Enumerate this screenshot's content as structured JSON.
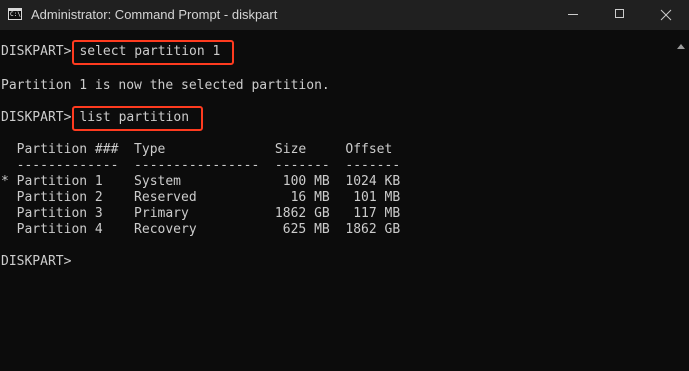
{
  "window": {
    "title": "Administrator: Command Prompt - diskpart",
    "controls": [
      "minimize-icon",
      "maximize-icon",
      "close-icon"
    ],
    "colors": {
      "background": "#0c0c0c",
      "titlebar": "#202020",
      "text": "#cccccc",
      "highlight": "#ff3b1f"
    }
  },
  "console": {
    "prompt1": "DISKPART>",
    "command1": "select partition 1",
    "output1": "Partition 1 is now the selected partition.",
    "prompt2": "DISKPART>",
    "command2": "list partition",
    "header": "  Partition ###  Type              Size     Offset",
    "separator": "  -------------  ----------------  -------  -------",
    "rows": [
      "* Partition 1    System             100 MB  1024 KB",
      "  Partition 2    Reserved            16 MB   101 MB",
      "  Partition 3    Primary           1862 GB   117 MB",
      "  Partition 4    Recovery           625 MB  1862 GB"
    ],
    "prompt3": "DISKPART>"
  }
}
